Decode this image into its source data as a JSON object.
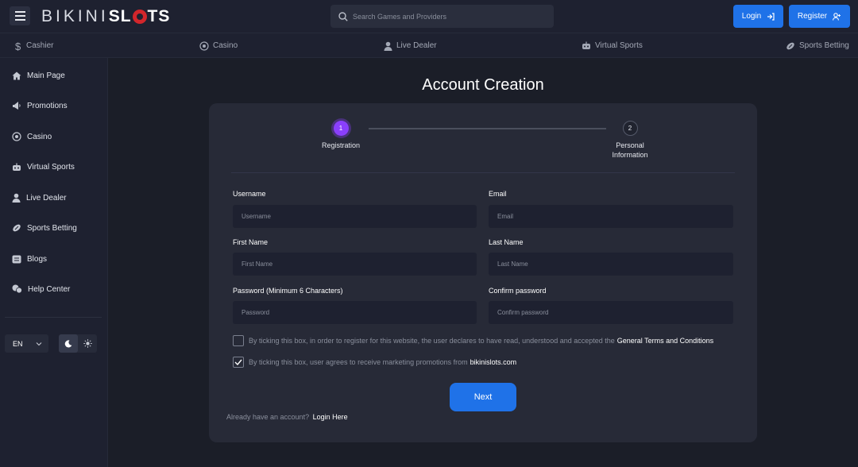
{
  "header": {
    "logo_part1": "BIKINI",
    "logo_part2": "SL",
    "logo_part3": "TS",
    "search_placeholder": "Search Games and Providers",
    "login_label": "Login",
    "register_label": "Register"
  },
  "categories": [
    {
      "label": "Cashier",
      "icon": "dollar-icon"
    },
    {
      "label": "Casino",
      "icon": "roulette-icon"
    },
    {
      "label": "Live Dealer",
      "icon": "dealer-icon"
    },
    {
      "label": "Virtual Sports",
      "icon": "robot-icon"
    },
    {
      "label": "Sports Betting",
      "icon": "football-icon"
    }
  ],
  "sidebar": {
    "items": [
      {
        "label": "Main Page",
        "icon": "home-icon"
      },
      {
        "label": "Promotions",
        "icon": "megaphone-icon"
      },
      {
        "label": "Casino",
        "icon": "roulette-icon"
      },
      {
        "label": "Virtual Sports",
        "icon": "robot-icon"
      },
      {
        "label": "Live Dealer",
        "icon": "dealer-icon"
      },
      {
        "label": "Sports Betting",
        "icon": "football-icon"
      },
      {
        "label": "Blogs",
        "icon": "blog-icon"
      },
      {
        "label": "Help Center",
        "icon": "help-icon"
      }
    ],
    "language": "EN"
  },
  "page": {
    "title": "Account Creation"
  },
  "steps": [
    {
      "number": "1",
      "label": "Registration",
      "active": true
    },
    {
      "number": "2",
      "label_line1": "Personal",
      "label_line2": "Information",
      "active": false
    }
  ],
  "form": {
    "username_label": "Username",
    "username_placeholder": "Username",
    "email_label": "Email",
    "email_placeholder": "Email",
    "first_name_label": "First Name",
    "first_name_placeholder": "First Name",
    "last_name_label": "Last Name",
    "last_name_placeholder": "Last Name",
    "password_label": "Password (Minimum 6 Characters)",
    "password_placeholder": "Password",
    "confirm_label": "Confirm password",
    "confirm_placeholder": "Confirm password",
    "terms_text": "By ticking this box, in order to register for this website, the user declares to have read, understood and accepted the",
    "terms_link": "General Terms and Conditions",
    "terms_checked": false,
    "marketing_text": "By ticking this box, user agrees to receive marketing promotions from",
    "marketing_link": "bikinislots.com",
    "marketing_checked": true,
    "next_label": "Next",
    "already_text": "Already have an account?",
    "login_here": "Login Here"
  },
  "colors": {
    "accent_blue": "#1f72e8",
    "step_active": "#8a3ffc",
    "logo_red": "#d2262b"
  }
}
